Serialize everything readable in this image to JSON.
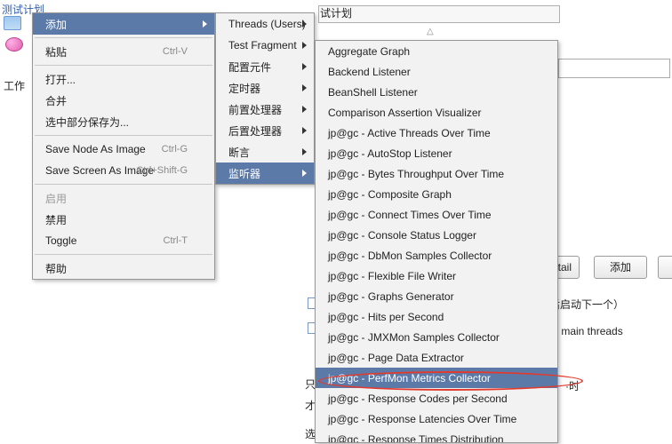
{
  "tree": {
    "root": "测试计划",
    "workspace": "工作"
  },
  "menu1": {
    "add": "添加",
    "paste": "粘贴",
    "paste_sc": "Ctrl-V",
    "open": "打开...",
    "merge": "合并",
    "savesel": "选中部分保存为...",
    "savenode": "Save Node As Image",
    "savenode_sc": "Ctrl-G",
    "savescreen": "Save Screen As Image",
    "savescreen_sc": "Ctrl+Shift-G",
    "enable": "启用",
    "disable": "禁用",
    "toggle": "Toggle",
    "toggle_sc": "Ctrl-T",
    "help": "帮助"
  },
  "menu2": {
    "threads": "Threads (Users)",
    "testfrag": "Test Fragment",
    "config": "配置元件",
    "timer": "定时器",
    "pre": "前置处理器",
    "post": "后置处理器",
    "assert": "断言",
    "listener": "监听器"
  },
  "menu3": {
    "items": [
      "Aggregate Graph",
      "Backend Listener",
      "BeanShell Listener",
      "Comparison Assertion Visualizer",
      "jp@gc - Active Threads Over Time",
      "jp@gc - AutoStop Listener",
      "jp@gc - Bytes Throughput Over Time",
      "jp@gc - Composite Graph",
      "jp@gc - Connect Times Over Time",
      "jp@gc - Console Status Logger",
      "jp@gc - DbMon Samples Collector",
      "jp@gc - Flexible File Writer",
      "jp@gc - Graphs Generator",
      "jp@gc - Hits per Second",
      "jp@gc - JMXMon Samples Collector",
      "jp@gc - Page Data Extractor",
      "jp@gc - PerfMon Metrics Collector",
      "jp@gc - Response Codes per Second",
      "jp@gc - Response Latencies Over Time",
      "jp@gc - Response Times Distribution"
    ],
    "highlight_index": 16
  },
  "bg": {
    "plan_title": "试计划",
    "sort_glyph": "△",
    "btn_detail": "etail",
    "btn_add": "添加",
    "text_after_start": "后启动下一个）",
    "text_main_threads": "of main threads",
    "text_shi": "·时",
    "cn_zhi": "只",
    "cn_cai": "才",
    "cn_xuan": "选"
  }
}
